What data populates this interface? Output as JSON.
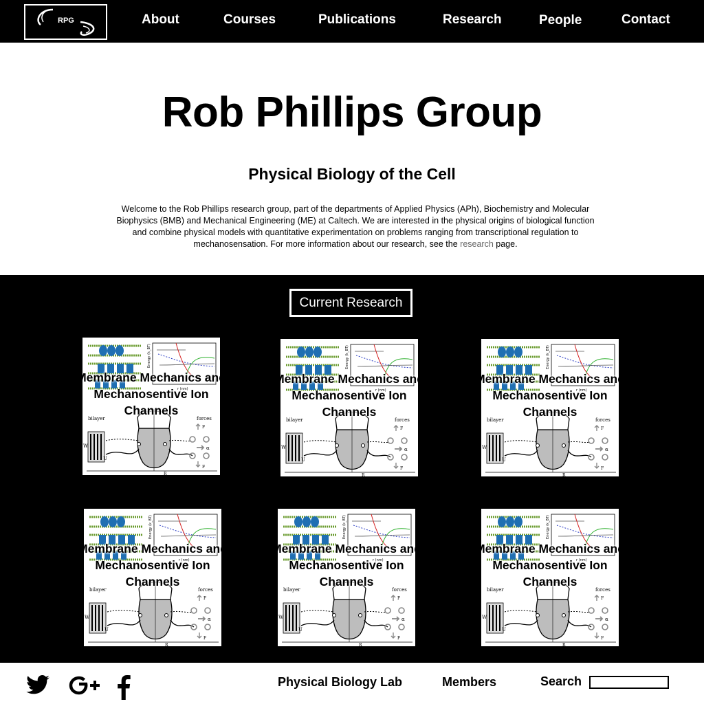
{
  "nav": {
    "logo_text": "RPG",
    "links": [
      "About",
      "Courses",
      "Publications",
      "Research",
      "People",
      "Contact"
    ]
  },
  "hero": {
    "title": "Rob Phillips Group",
    "subtitle": "Physical Biology of the Cell",
    "body_before_link": "Welcome to the Rob Phillips research group, part of the departments of Applied Physics (APh), Biochemistry and Molecular Biophysics (BMB) and Mechanical Engineering (ME) at Caltech. We are interested in the physical origins of biological function and combine physical models with quantitative experimentation on problems ranging from transcriptional regulation to mechanosensation. For more information about our research, see the",
    "link_text": "research",
    "body_after_link": "page."
  },
  "research": {
    "heading": "Current Research",
    "cards": [
      {
        "title": "Membrane Mechanics and Mechanosentive Ion Channels"
      },
      {
        "title": "Membrane Mechanics and Mechanosentive Ion Channels"
      },
      {
        "title": "Membrane Mechanics and Mechanosentive Ion Channels"
      },
      {
        "title": "Membrane Mechanics and Mechanosentive Ion Channels"
      },
      {
        "title": "Membrane Mechanics and Mechanosentive Ion Channels"
      },
      {
        "title": "Membrane Mechanics and Mechanosentive Ion Channels"
      }
    ],
    "figure_labels": {
      "bilayer": "bilayer",
      "inclusion": "inclusion",
      "forces": "forces",
      "W": "W",
      "U": "U",
      "F": "F",
      "alpha": "α",
      "R": "R",
      "ylabel": "Energy (k_BT)",
      "xlabel": "r (nm)"
    }
  },
  "footer": {
    "links": [
      "Physical Biology Lab",
      "Members"
    ],
    "search_label": "Search",
    "search_value": ""
  }
}
